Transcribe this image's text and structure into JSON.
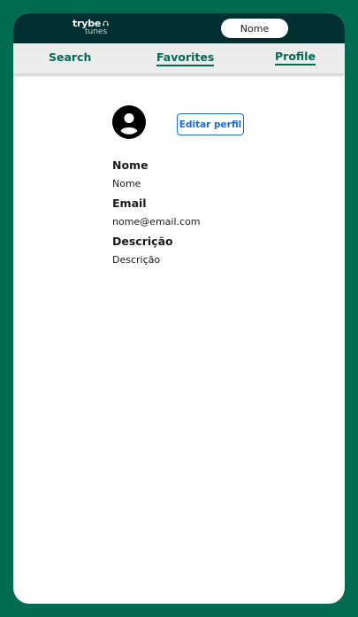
{
  "header": {
    "logo_line1": "trybe",
    "logo_line2": "tunes",
    "user_name": "Nome"
  },
  "nav": {
    "items": [
      {
        "label": "Search",
        "active": false
      },
      {
        "label": "Favorites",
        "active": true
      },
      {
        "label": "Profile",
        "active": true
      }
    ]
  },
  "profile": {
    "edit_label": "Editar perfil",
    "fields": [
      {
        "label": "Nome",
        "value": "Nome"
      },
      {
        "label": "Email",
        "value": "nome@email.com"
      },
      {
        "label": "Descrição",
        "value": "Descrição"
      }
    ]
  },
  "colors": {
    "frame": "#036b52",
    "header": "#023031",
    "nav_bg": "#ececec",
    "accent": "#036b52",
    "button": "#1e6bd6"
  }
}
